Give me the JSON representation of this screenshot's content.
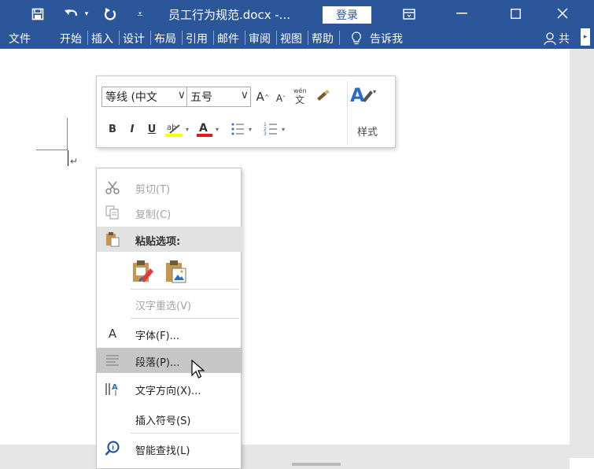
{
  "titlebar": {
    "doc_title": "员工行为规范.docx -...",
    "login_label": "登录",
    "colors": {
      "bar": "#2b579a",
      "text": "#ffffff"
    },
    "icons": [
      "save-icon",
      "undo-icon",
      "redo-icon",
      "customize-qat-icon",
      "ribbon-display-icon",
      "minimize-icon",
      "maximize-icon",
      "close-icon"
    ]
  },
  "ribbon": {
    "tabs": [
      "文件",
      "开始",
      "插入",
      "设计",
      "布局",
      "引用",
      "邮件",
      "审阅",
      "视图",
      "帮助"
    ],
    "tell_me": "告诉我",
    "share": "共"
  },
  "mini_toolbar": {
    "font_name": "等线 (中文",
    "font_size": "五号",
    "styles_label": "样式"
  },
  "context_menu": {
    "cut": "剪切(T)",
    "copy": "复制(C)",
    "paste_options": "粘贴选项:",
    "reconvert": "汉字重选(V)",
    "font": "字体(F)...",
    "paragraph": "段落(P)...",
    "text_direction": "文字方向(X)...",
    "insert_symbol": "插入符号(S)",
    "smart_lookup": "智能查找(L)"
  }
}
